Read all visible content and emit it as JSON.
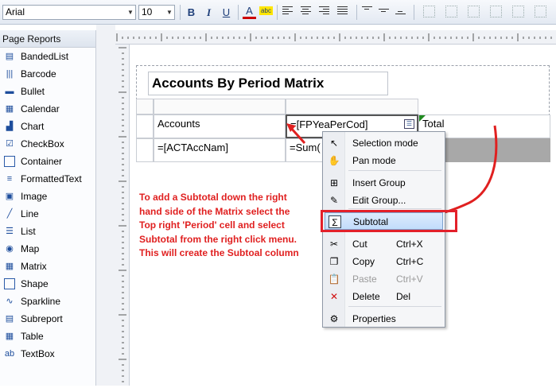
{
  "toolbar": {
    "font_family": "Arial",
    "font_size": "10",
    "bold": "B",
    "italic": "I",
    "underline": "U",
    "font_color_icon": "A",
    "highlight_icon": "abc"
  },
  "sidebar": {
    "title": "Page Reports",
    "items": [
      {
        "label": "BandedList",
        "icon": "banded-list-icon",
        "glyph": "▤"
      },
      {
        "label": "Barcode",
        "icon": "barcode-icon",
        "glyph": "|||"
      },
      {
        "label": "Bullet",
        "icon": "bullet-icon",
        "glyph": "▬"
      },
      {
        "label": "Calendar",
        "icon": "calendar-icon",
        "glyph": "▦"
      },
      {
        "label": "Chart",
        "icon": "chart-icon",
        "glyph": "▟"
      },
      {
        "label": "CheckBox",
        "icon": "checkbox-icon",
        "glyph": "☑"
      },
      {
        "label": "Container",
        "icon": "container-icon",
        "glyph": ""
      },
      {
        "label": "FormattedText",
        "icon": "formatted-text-icon",
        "glyph": "≡"
      },
      {
        "label": "Image",
        "icon": "image-icon",
        "glyph": "▣"
      },
      {
        "label": "Line",
        "icon": "line-icon",
        "glyph": "╱"
      },
      {
        "label": "List",
        "icon": "list-icon",
        "glyph": "☰"
      },
      {
        "label": "Map",
        "icon": "map-icon",
        "glyph": "◉"
      },
      {
        "label": "Matrix",
        "icon": "matrix-icon",
        "glyph": "▦"
      },
      {
        "label": "Shape",
        "icon": "shape-icon",
        "glyph": ""
      },
      {
        "label": "Sparkline",
        "icon": "sparkline-icon",
        "glyph": "∿"
      },
      {
        "label": "Subreport",
        "icon": "subreport-icon",
        "glyph": "▤"
      },
      {
        "label": "Table",
        "icon": "table-icon",
        "glyph": "▦"
      },
      {
        "label": "TextBox",
        "icon": "textbox-icon",
        "glyph": "ab"
      }
    ]
  },
  "report": {
    "title": "Accounts By Period Matrix",
    "cells": {
      "corner": "Accounts",
      "column_group": "=[FPYeaPerCod]",
      "total": "Total",
      "row_group": "=[ACTAccNam]",
      "detail": "=Sum("
    }
  },
  "context_menu": {
    "items": [
      {
        "label": "Selection mode",
        "shortcut": "",
        "icon": "pointer-icon",
        "glyph": "↖"
      },
      {
        "label": "Pan mode",
        "shortcut": "",
        "icon": "hand-icon",
        "glyph": "✋"
      },
      {
        "label": "Insert Group",
        "shortcut": "",
        "icon": "insert-group-icon",
        "glyph": "⊞"
      },
      {
        "label": "Edit Group...",
        "shortcut": "",
        "icon": "edit-group-icon",
        "glyph": "✎"
      },
      {
        "label": "Subtotal",
        "shortcut": "",
        "icon": "sigma-icon",
        "glyph": "Σ"
      },
      {
        "label": "Cut",
        "shortcut": "Ctrl+X",
        "icon": "scissors-icon",
        "glyph": "✂"
      },
      {
        "label": "Copy",
        "shortcut": "Ctrl+C",
        "icon": "copy-icon",
        "glyph": "❐"
      },
      {
        "label": "Paste",
        "shortcut": "Ctrl+V",
        "icon": "paste-icon",
        "glyph": "📋"
      },
      {
        "label": "Delete",
        "shortcut": "Del",
        "icon": "delete-icon",
        "glyph": "✕"
      },
      {
        "label": "Properties",
        "shortcut": "",
        "icon": "properties-icon",
        "glyph": "⚙"
      }
    ]
  },
  "annotation": {
    "text": "To add a Subtotal down the right hand side of the Matrix select the Top right 'Period' cell and select Subtotal from the right click menu. This will create the Subtoal column"
  },
  "colors": {
    "annotation": "#e02020",
    "highlight": "#e3202a",
    "menu_highlight": "#c2dcfb"
  }
}
